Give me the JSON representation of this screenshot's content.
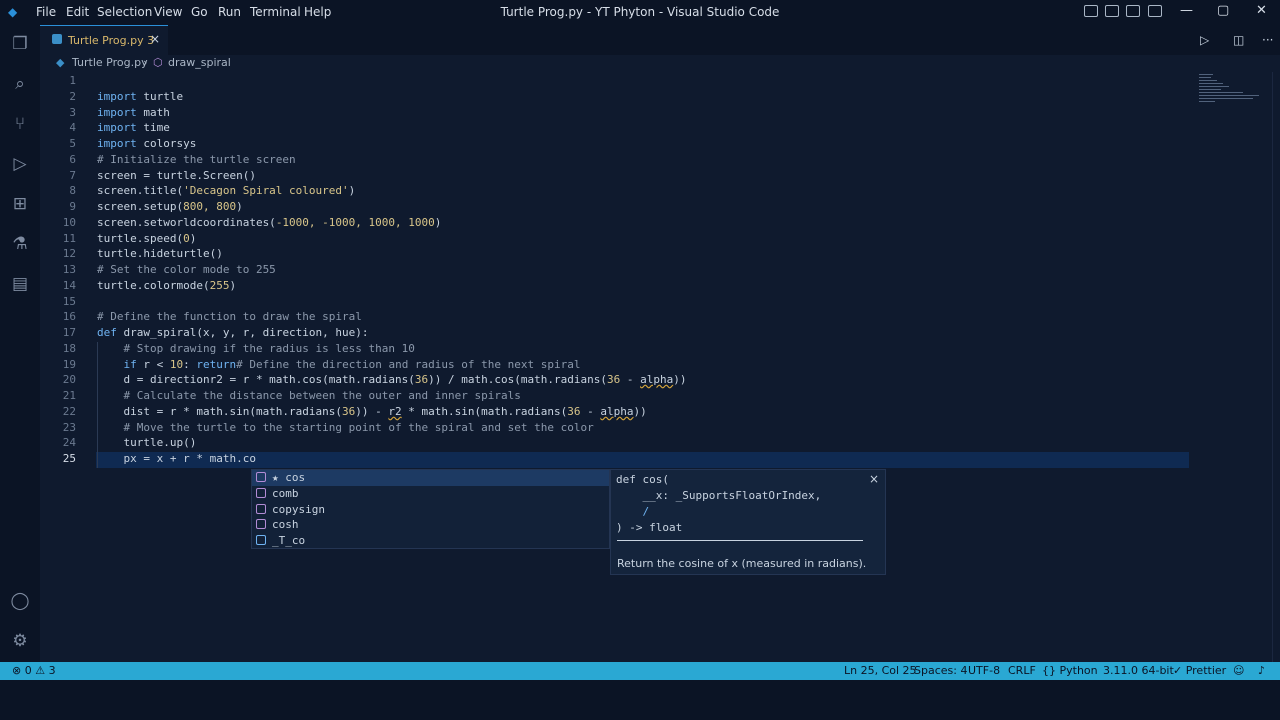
{
  "menu": [
    "File",
    "Edit",
    "Selection",
    "View",
    "Go",
    "Run",
    "Terminal",
    "Help"
  ],
  "window_title": "Turtle Prog.py - YT Phyton - Visual Studio Code",
  "tab": {
    "label": "Turtle Prog.py 3",
    "close": "×"
  },
  "breadcrumb": {
    "file": "Turtle Prog.py",
    "sep": "›",
    "symbol": "draw_spiral"
  },
  "line_numbers": [
    "1",
    "2",
    "3",
    "4",
    "5",
    "6",
    "7",
    "8",
    "9",
    "10",
    "11",
    "12",
    "13",
    "14",
    "15",
    "16",
    "17",
    "18",
    "19",
    "20",
    "21",
    "22",
    "23",
    "24",
    "25"
  ],
  "code": {
    "l2_kw": "import",
    "l2_rest": " turtle",
    "l3_kw": "import",
    "l3_rest": " math",
    "l4_kw": "import",
    "l4_rest": " time",
    "l5_kw": "import",
    "l5_rest": " colorsys",
    "l6": "# Initialize the turtle screen",
    "l7": "screen = turtle.Screen()",
    "l8a": "screen.title(",
    "l8s": "'Decagon Spiral coloured'",
    "l8b": ")",
    "l9a": "screen.setup(",
    "l9n": "800, 800",
    "l9b": ")",
    "l10a": "screen.setworldcoordinates(",
    "l10n": "-1000, -1000, 1000, 1000",
    "l10b": ")",
    "l11a": "turtle.speed(",
    "l11n": "0",
    "l11b": ")",
    "l12": "turtle.hideturtle()",
    "l13": "# Set the color mode to 255",
    "l14a": "turtle.colormode(",
    "l14n": "255",
    "l14b": ")",
    "l16": "# Define the function to draw the spiral",
    "l17_kw": "def",
    "l17_rest": " draw_spiral(x, y, r, direction, hue):",
    "l18": "    # Stop drawing if the radius is less than 10",
    "l19_a": "    if",
    "l19_b": " r < ",
    "l19_n": "10",
    "l19_c": ": ",
    "l19_kw": "return",
    "l19_cm": "# Define the direction and radius of the next spiral",
    "l20_a": "    d = directionr2 = r * math.cos(math.radians(",
    "l20_n": "36",
    "l20_b": ")) / math.cos(math.radians(",
    "l20_n2": "36",
    "l20_c": " - ",
    "l20_e": "alpha",
    "l20_d": "))",
    "l21": "    # Calculate the distance between the outer and inner spirals",
    "l22_a": "    dist = r * math.sin(math.radians(",
    "l22_n": "36",
    "l22_b": ")) - ",
    "l22_e": "r2",
    "l22_c": " * math.sin(math.radians(",
    "l22_n2": "36",
    "l22_d": " - ",
    "l22_e2": "alpha",
    "l22_f": "))",
    "l23": "    # Move the turtle to the starting point of the spiral and set the color",
    "l24": "    turtle.up()",
    "l25": "    px = x + r * math.co"
  },
  "suggestions": [
    {
      "label": "★ cos",
      "icon": "method-icon"
    },
    {
      "label": "comb",
      "icon": "method-icon"
    },
    {
      "label": "copysign",
      "icon": "method-icon"
    },
    {
      "label": "cosh",
      "icon": "method-icon"
    },
    {
      "label": "_T_co",
      "icon": "variable-icon"
    }
  ],
  "detail": {
    "line1": "def cos(",
    "line2": "    __x: _SupportsFloatOrIndex,",
    "line3": "    /",
    "line4": ") -> float",
    "doc": "Return the cosine of x (measured in radians).",
    "close": "×"
  },
  "status": {
    "errors": "⊗ 0 ⚠ 3",
    "position": "Ln 25, Col 25",
    "spaces": "Spaces: 4",
    "encoding": "UTF-8",
    "eol": "CRLF",
    "language": "{} Python",
    "interpreter": "3.11.0 64-bit",
    "prettier": "✓ Prettier"
  },
  "colors": {
    "accent": "#2aa8d3",
    "background": "#0f1a2e",
    "keyword": "#6fb3f2"
  }
}
